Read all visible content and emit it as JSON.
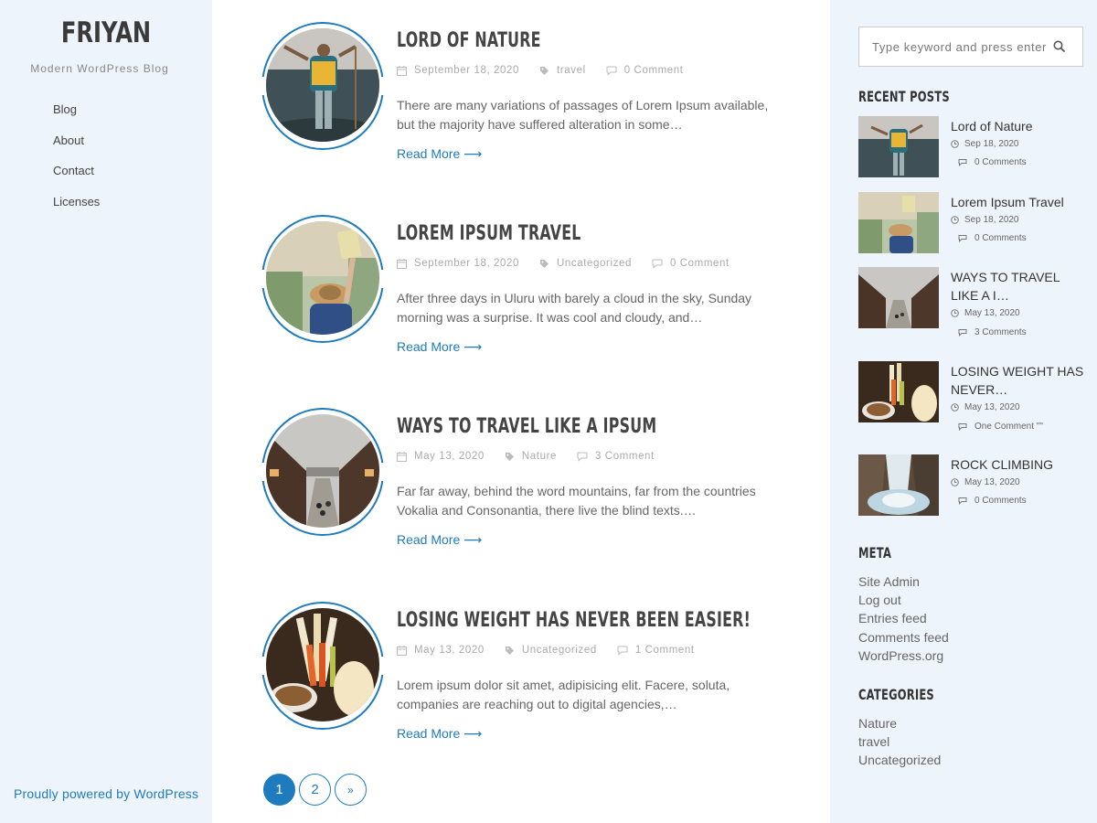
{
  "site": {
    "title": "FRIYAN",
    "description": "Modern WordPress Blog",
    "powered_by": "Proudly powered by WordPress"
  },
  "nav": {
    "items": [
      {
        "label": "Blog"
      },
      {
        "label": "About"
      },
      {
        "label": "Contact"
      },
      {
        "label": "Licenses"
      }
    ]
  },
  "posts": [
    {
      "title": "LORD OF NATURE",
      "date": "September 18, 2020",
      "category": "travel",
      "comments": "0 Comment",
      "excerpt": "There are many variations of passages of Lorem Ipsum available, but the majority have suffered alteration in some…",
      "read_more": "Read More ⟶"
    },
    {
      "title": "LOREM IPSUM TRAVEL",
      "date": "September 18, 2020",
      "category": "Uncategorized",
      "comments": "0 Comment",
      "excerpt": "After three days in Uluru with barely a cloud in the sky, Sunday morning was a surprise. It was cool and cloudy, and…",
      "read_more": "Read More ⟶"
    },
    {
      "title": "WAYS TO TRAVEL LIKE A IPSUM",
      "date": "May 13, 2020",
      "category": "Nature",
      "comments": "3 Comment",
      "excerpt": "Far far away, behind the word mountains, far from the countries Vokalia and Consonantia, there live the blind texts.…",
      "read_more": "Read More ⟶"
    },
    {
      "title": "LOSING WEIGHT HAS NEVER BEEN EASIER!",
      "date": "May 13, 2020",
      "category": "Uncategorized",
      "comments": "1 Comment",
      "excerpt": "Lorem ipsum dolor sit amet, adipisicing elit. Facere, soluta, companies are reaching out to digital agencies,…",
      "read_more": "Read More ⟶"
    }
  ],
  "pagination": {
    "pages": [
      "1",
      "2"
    ],
    "next": "»"
  },
  "search": {
    "placeholder": "Type keyword and press enter"
  },
  "recent_posts": {
    "title": "RECENT POSTS",
    "items": [
      {
        "title": "Lord of Nature",
        "date": "Sep 18, 2020",
        "comments": "0 Comments"
      },
      {
        "title": "Lorem Ipsum Travel",
        "date": "Sep 18, 2020",
        "comments": "0 Comments"
      },
      {
        "title": "WAYS TO TRAVEL LIKE A I…",
        "date": "May 13, 2020",
        "comments": "3 Comments"
      },
      {
        "title": "LOSING WEIGHT HAS NEVER…",
        "date": "May 13, 2020",
        "comments": "One Comment \"\""
      },
      {
        "title": "ROCK CLIMBING",
        "date": "May 13, 2020",
        "comments": "0 Comments"
      }
    ]
  },
  "meta_widget": {
    "title": "META",
    "items": [
      "Site Admin",
      "Log out",
      "Entries feed",
      "Comments feed",
      "WordPress.org"
    ]
  },
  "categories_widget": {
    "title": "CATEGORIES",
    "items": [
      "Nature",
      "travel",
      "Uncategorized"
    ]
  },
  "colors": {
    "accent": "#1e7bbd",
    "sidebar_bg": "#eef4fb"
  }
}
